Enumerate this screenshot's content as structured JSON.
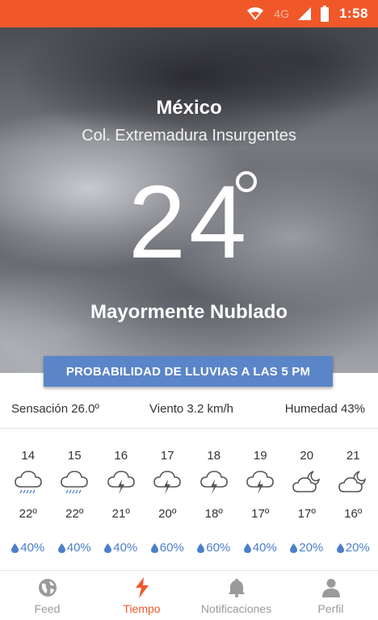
{
  "status_bar": {
    "network": "4G",
    "time": "1:58",
    "color": "#f0582a"
  },
  "location": {
    "city": "México",
    "colony": "Col. Extremadura Insurgentes"
  },
  "current": {
    "temperature": "24",
    "condition": "Mayormente Nublado"
  },
  "rain_button": {
    "label": "PROBABILIDAD DE LLUVIAS A LAS 5 PM",
    "color": "#5a85c8"
  },
  "stats": {
    "feels_like": "Sensación 26.0º",
    "wind": "Viento 3.2 km/h",
    "humidity": "Humedad 43%"
  },
  "forecast": [
    {
      "day": "14",
      "icon": "cloud-rain-icon",
      "temp": "22º",
      "precip": "40%"
    },
    {
      "day": "15",
      "icon": "cloud-rain-icon",
      "temp": "22º",
      "precip": "40%"
    },
    {
      "day": "16",
      "icon": "cloud-lightning-icon",
      "temp": "21º",
      "precip": "40%"
    },
    {
      "day": "17",
      "icon": "cloud-lightning-icon",
      "temp": "20º",
      "precip": "60%"
    },
    {
      "day": "18",
      "icon": "cloud-lightning-icon",
      "temp": "18º",
      "precip": "60%"
    },
    {
      "day": "19",
      "icon": "cloud-lightning-icon",
      "temp": "17º",
      "precip": "40%"
    },
    {
      "day": "20",
      "icon": "cloud-moon-icon",
      "temp": "17º",
      "precip": "20%"
    },
    {
      "day": "21",
      "icon": "cloud-moon-icon",
      "temp": "16º",
      "precip": "20%"
    }
  ],
  "nav": {
    "items": [
      {
        "label": "Feed",
        "icon": "globe-icon",
        "active": false
      },
      {
        "label": "Tiempo",
        "icon": "lightning-bolt-icon",
        "active": true
      },
      {
        "label": "Notificaciones",
        "icon": "bell-icon",
        "active": false
      },
      {
        "label": "Perfil",
        "icon": "person-icon",
        "active": false
      }
    ],
    "active_color": "#f0582a",
    "inactive_color": "#9a9a9a"
  }
}
